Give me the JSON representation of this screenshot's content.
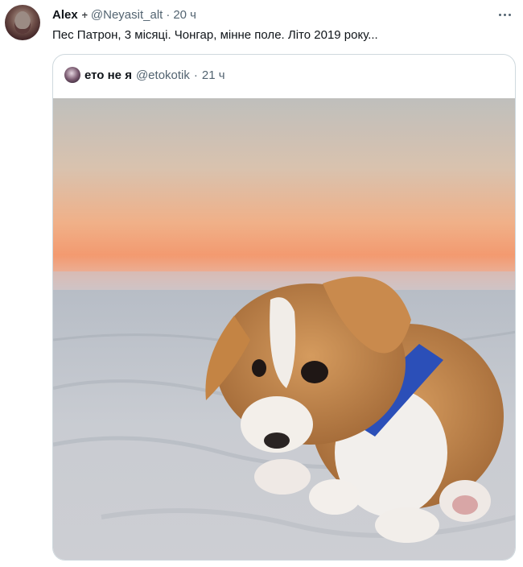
{
  "tweet": {
    "author_name": "Alex",
    "author_badge": "🕂",
    "handle": "@Neyasit_alt",
    "separator": "·",
    "time": "20 ч",
    "text": "Пес Патрон, 3 місяці. Чонгар, мінне поле. Літо 2019 року..."
  },
  "quoted": {
    "author_name": "ето не я",
    "handle": "@etokotik",
    "separator": "·",
    "time": "21 ч",
    "image_subject": "corgi puppy sitting on sand at sunset"
  },
  "icons": {
    "more": "more-horizontal-icon"
  },
  "colors": {
    "text": "#0f1419",
    "muted": "#536471",
    "border": "#cfd9de",
    "sky_top": "#c9c6c0",
    "sky_glow": "#f0a268",
    "sand": "#c8ccd2"
  }
}
